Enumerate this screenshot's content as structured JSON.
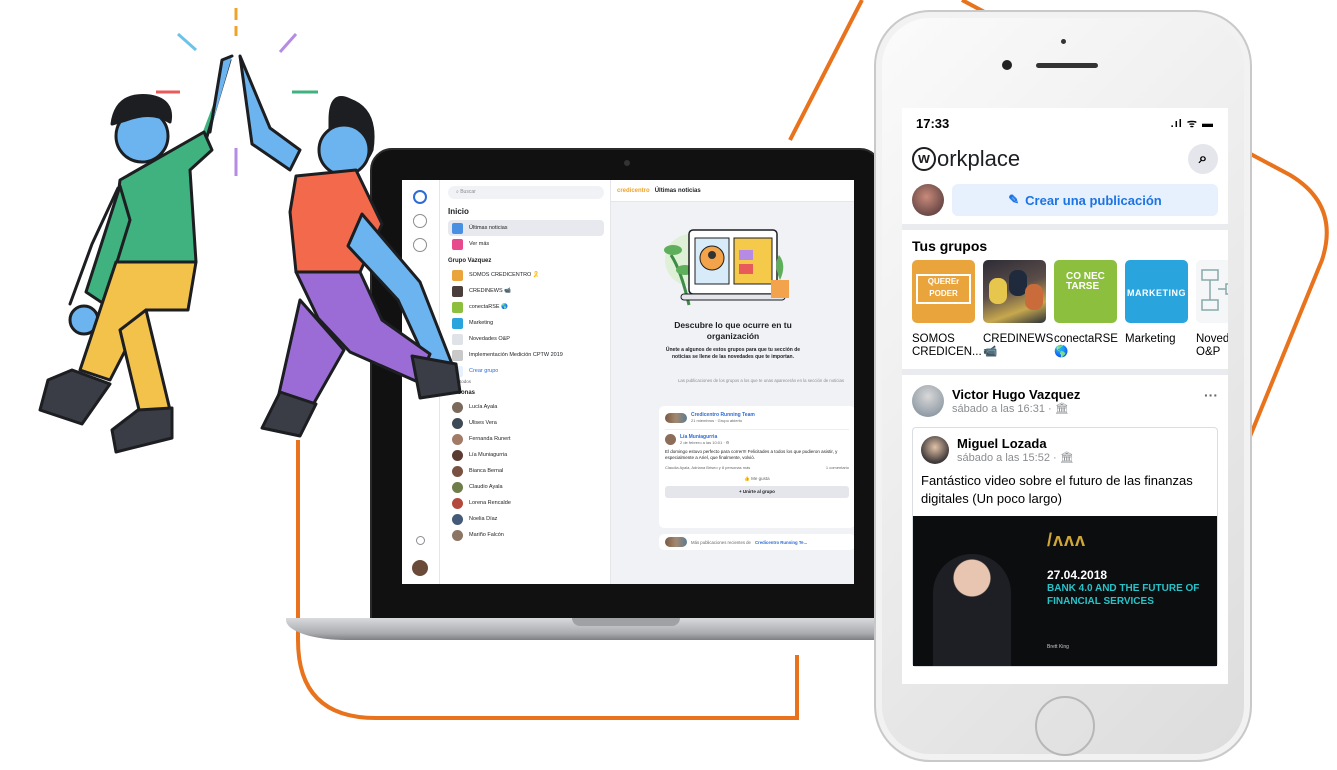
{
  "laptop": {
    "search_placeholder": "Buscar",
    "home_title": "Inicio",
    "nav": [
      {
        "label": "Últimas noticias",
        "color": "#4a90e2"
      },
      {
        "label": "Ver más",
        "color": "#e64a8c"
      }
    ],
    "groups_heading": "Grupo Vazquez",
    "groups": [
      {
        "label": "SOMOS CREDICENTRO 🎗️",
        "color": "#e9a43c"
      },
      {
        "label": "CREDINEWS 📹",
        "color": "#4a3d3a"
      },
      {
        "label": "conectaRSE 🌎",
        "color": "#8dbf3f"
      },
      {
        "label": "Marketing",
        "color": "#2aa4dd"
      },
      {
        "label": "Novedades O&P",
        "color": "#dfe3e8"
      },
      {
        "label": "Implementación Medición CPTW 2019",
        "color": "#c9c9c9"
      }
    ],
    "create_group": "Crear grupo",
    "see_all": "Ver todos",
    "people_heading": "Personas",
    "people": [
      "Lucía Ayala",
      "Ulises Vera",
      "Fernanda Runert",
      "Lía Muniagurria",
      "Bianca Bernal",
      "Claudio Ayala",
      "Lorena Rencalde",
      "Noelia Díaz",
      "Mariño Falcón"
    ],
    "topbar_brand": "credicentro",
    "topbar_title": "Últimas noticias",
    "discover_title": "Descubre lo que ocurre en tu organización",
    "discover_sub": "Únete a algunos de estos grupos para que tu sección de noticias se llene de las novedades que te importan.",
    "discover_note": "Las publicaciones de los grupos a los que te unas aparecerán en la sección de noticias",
    "group_card": {
      "name": "Credicentro Running Team",
      "meta": "21 miembros · Grupo abierto",
      "author": "Lía Muniagurria",
      "time": "2 de febrero a las 10:01 · ⚙",
      "text": "El domingo estuvo perfecto para correr!!! Felicitades a todos los que pudieron asistir, y especialmente a Ariel, que finalmente, volvió.",
      "reactions": "Claudia Ayala, Adriana Briseo y 8 personas más",
      "comments": "1 comentario",
      "like": "Me gusta",
      "join": "+ Unirte al grupo"
    },
    "more_posts": "Más publicaciones recientes de",
    "more_group": "Credicentro Running Te..."
  },
  "phone": {
    "time": "17:33",
    "signal": ".ıl ᯤ ▬",
    "logo_rest": "orkplace",
    "logo_w": "w",
    "create_post": "Crear una publicación",
    "groups_heading": "Tus grupos",
    "groups": [
      {
        "name": "SOMOS CREDICEN...",
        "thumb_text": "QUEREr PODER"
      },
      {
        "name": "CREDINEWS 📹",
        "thumb_text": ""
      },
      {
        "name": "conectaRSE 🌎",
        "thumb_text": "CO NEC TARSE"
      },
      {
        "name": "Marketing",
        "thumb_text": "MARKETING"
      },
      {
        "name": "Novedades O&P",
        "thumb_text": ""
      }
    ],
    "post": {
      "author": "Victor Hugo Vazquez",
      "meta": "sábado a las 16:31 · 🏛",
      "shared_author": "Miguel Lozada",
      "shared_meta": "sábado a las 15:52 · 🏛",
      "text": "Fantástico video sobre el futuro de las finanzas digitales (Un poco largo)",
      "video_brand": "/ʌʌʌ",
      "video_date": "27.04.2018",
      "video_title": "BANK 4.0 AND THE FUTURE OF FINANCIAL SERVICES",
      "video_speaker": "Brett King"
    }
  },
  "colors": {
    "accent": "#1b74e4",
    "orange": "#e8731c"
  }
}
